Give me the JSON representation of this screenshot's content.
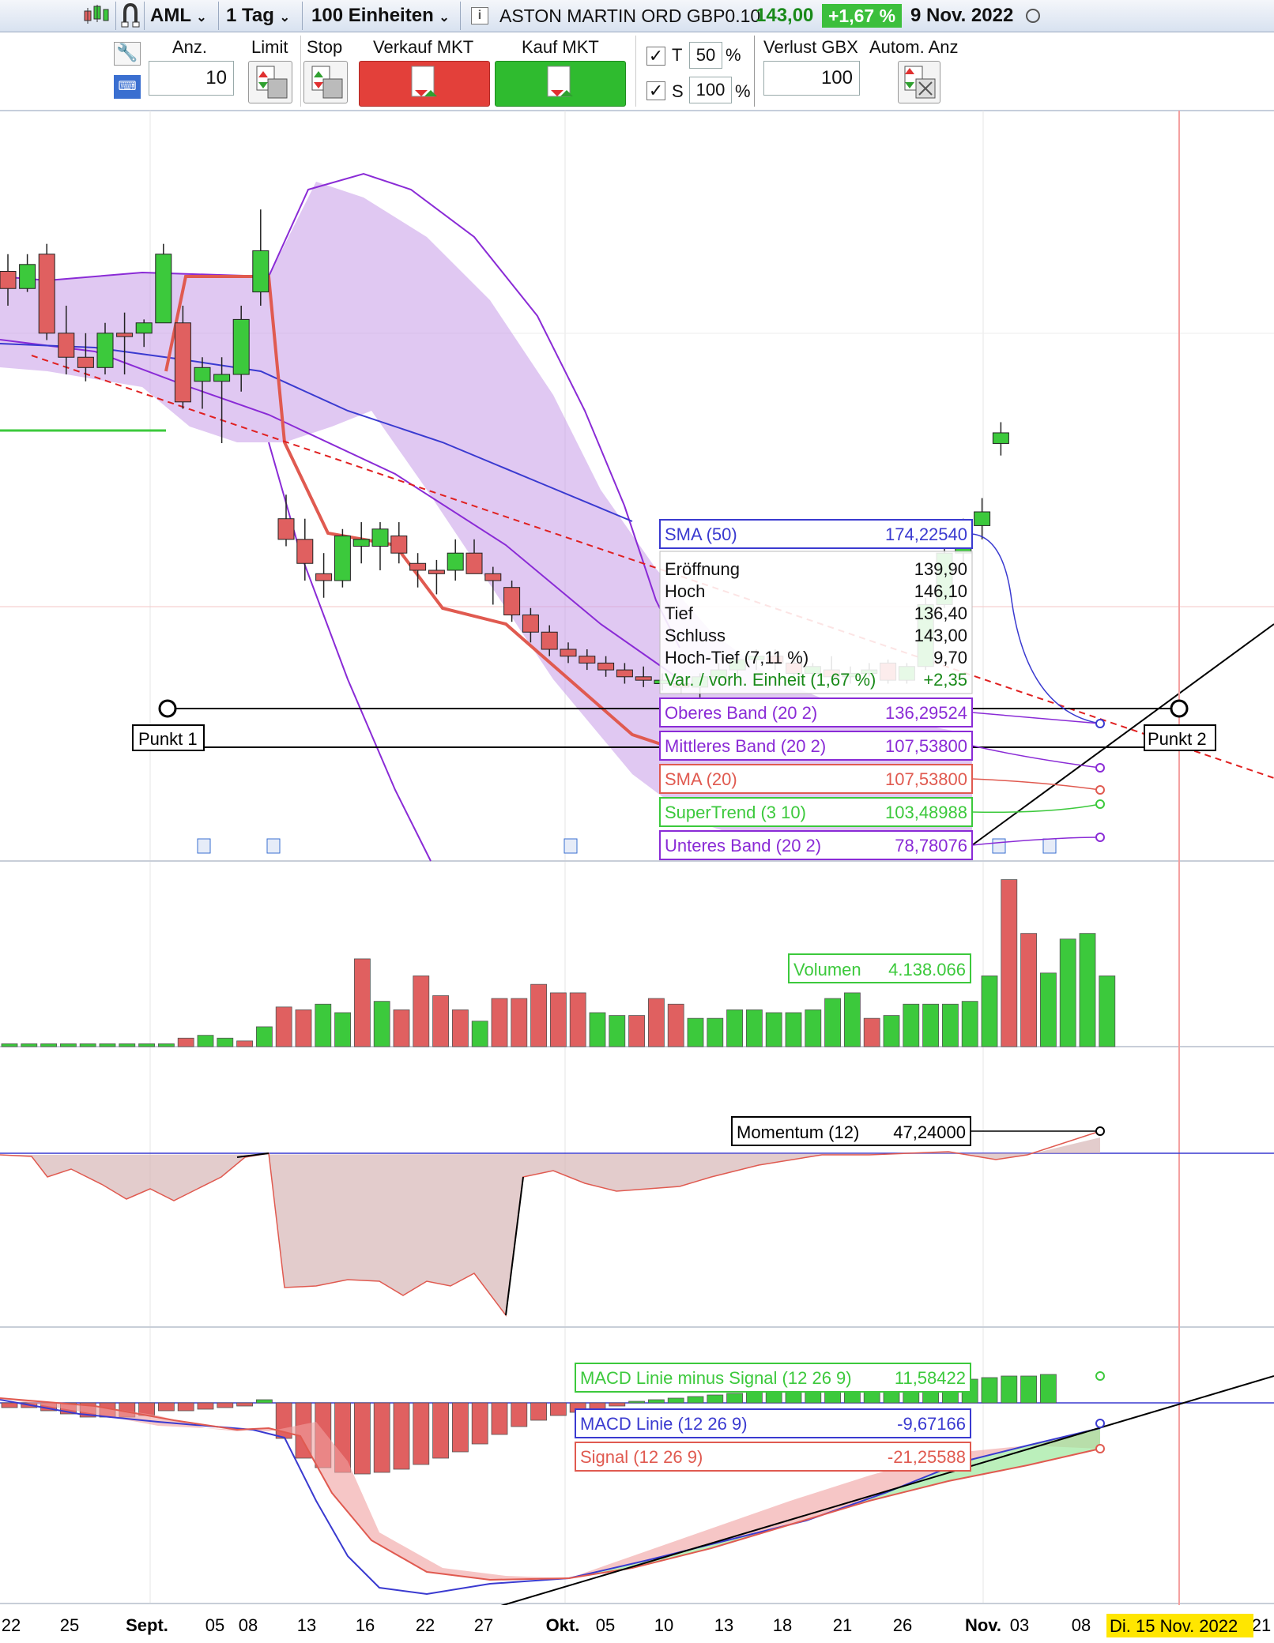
{
  "header": {
    "symbol": "AML",
    "interval": "1 Tag",
    "units": "100 Einheiten",
    "instrument": "ASTON MARTIN ORD GBP0.10",
    "last_price": "143,00",
    "change_pct": "+1,67 %",
    "date": "9 Nov. 2022"
  },
  "toolbar": {
    "qty_label": "Anz.",
    "qty_value": "10",
    "limit_label": "Limit",
    "stop_label": "Stop",
    "sell_label": "Verkauf MKT",
    "buy_label": "Kauf MKT",
    "t_label": "T",
    "t_value": "50",
    "s_label": "S",
    "s_value": "100",
    "pct": "%",
    "loss_label": "Verlust GBX",
    "loss_value": "100",
    "auto_label": "Autom. Anz"
  },
  "tooltip": {
    "rows": [
      {
        "label": "Eröffnung",
        "value": "139,90"
      },
      {
        "label": "Hoch",
        "value": "146,10"
      },
      {
        "label": "Tief",
        "value": "136,40"
      },
      {
        "label": "Schluss",
        "value": "143,00"
      },
      {
        "label": "Hoch-Tief (7,11 %)",
        "value": "9,70"
      },
      {
        "label": "Var. / vorh. Einheit (1,67 %)",
        "value": "+2,35"
      }
    ]
  },
  "indicators": {
    "sma50": {
      "label": "SMA (50)",
      "value": "174,22540"
    },
    "upper": {
      "label": "Oberes Band (20 2)",
      "value": "136,29524"
    },
    "middle": {
      "label": "Mittleres Band (20 2)",
      "value": "107,53800"
    },
    "sma20": {
      "label": "SMA (20)",
      "value": "107,53800"
    },
    "supertrend": {
      "label": "SuperTrend (3 10)",
      "value": "103,48988"
    },
    "lower": {
      "label": "Unteres Band (20 2)",
      "value": "78,78076"
    },
    "volume": {
      "label": "Volumen",
      "value": "4.138.066"
    },
    "momentum": {
      "label": "Momentum (12)",
      "value": "47,24000"
    },
    "macd_hist": {
      "label": "MACD Linie minus Signal (12 26 9)",
      "value": "11,58422"
    },
    "macd_line": {
      "label": "MACD Linie (12 26 9)",
      "value": "-9,67166"
    },
    "macd_signal": {
      "label": "Signal (12 26 9)",
      "value": "-21,25588"
    }
  },
  "annotations": {
    "point1": "Punkt 1",
    "point2": "Punkt 2",
    "cursor_date": "Di. 15 Nov. 2022"
  },
  "colors": {
    "up": "#3cc93c",
    "down": "#e06060",
    "bands": "#8a2bd6",
    "sma50": "#3a3ad0",
    "sma20": "#e05a50",
    "supertrend": "#3cc93c"
  },
  "chart_data": {
    "type": "candlestick",
    "x_labels": [
      {
        "text": "22",
        "bold": false
      },
      {
        "text": "25",
        "bold": false
      },
      {
        "text": "Sept.",
        "bold": true
      },
      {
        "text": "05",
        "bold": false
      },
      {
        "text": "08",
        "bold": false
      },
      {
        "text": "13",
        "bold": false
      },
      {
        "text": "16",
        "bold": false
      },
      {
        "text": "22",
        "bold": false
      },
      {
        "text": "27",
        "bold": false
      },
      {
        "text": "Okt.",
        "bold": true
      },
      {
        "text": "05",
        "bold": false
      },
      {
        "text": "10",
        "bold": false
      },
      {
        "text": "13",
        "bold": false
      },
      {
        "text": "18",
        "bold": false
      },
      {
        "text": "21",
        "bold": false
      },
      {
        "text": "26",
        "bold": false
      },
      {
        "text": "Nov.",
        "bold": true
      },
      {
        "text": "03",
        "bold": false
      },
      {
        "text": "08",
        "bold": false
      },
      {
        "text": "21",
        "bold": false
      }
    ],
    "candles": [
      [
        190,
        195,
        180,
        185
      ],
      [
        185,
        195,
        184,
        192
      ],
      [
        195,
        198,
        170,
        172
      ],
      [
        172,
        180,
        160,
        165
      ],
      [
        165,
        172,
        158,
        162
      ],
      [
        162,
        175,
        160,
        172
      ],
      [
        172,
        178,
        160,
        171
      ],
      [
        172,
        176,
        168,
        175
      ],
      [
        175,
        198,
        176,
        195
      ],
      [
        175,
        180,
        150,
        152
      ],
      [
        158,
        165,
        150,
        162
      ],
      [
        158,
        165,
        140,
        160
      ],
      [
        160,
        180,
        155,
        176
      ],
      [
        184,
        208,
        180,
        196
      ],
      [
        118,
        125,
        110,
        112
      ],
      [
        112,
        118,
        100,
        105
      ],
      [
        102,
        108,
        95,
        100
      ],
      [
        100,
        115,
        98,
        113
      ],
      [
        110,
        117,
        105,
        112
      ],
      [
        110,
        117,
        103,
        115
      ],
      [
        113,
        117,
        105,
        108
      ],
      [
        105,
        108,
        98,
        103
      ],
      [
        103,
        106,
        96,
        102
      ],
      [
        103,
        112,
        100,
        108
      ],
      [
        108,
        112,
        102,
        102
      ],
      [
        102,
        104,
        93,
        100
      ],
      [
        98,
        100,
        88,
        90
      ],
      [
        90,
        92,
        82,
        85
      ],
      [
        85,
        87,
        78,
        80
      ],
      [
        80,
        82,
        76,
        78
      ],
      [
        78,
        80,
        74,
        76
      ],
      [
        76,
        78,
        72,
        74
      ],
      [
        74,
        76,
        70,
        72
      ],
      [
        72,
        75,
        69,
        71
      ],
      [
        70,
        73,
        68,
        71
      ],
      [
        70,
        72,
        67,
        69
      ],
      [
        69,
        73,
        66,
        72
      ],
      [
        72,
        76,
        70,
        74
      ],
      [
        74,
        78,
        71,
        77
      ],
      [
        77,
        80,
        74,
        78
      ],
      [
        78,
        80,
        74,
        76
      ],
      [
        76,
        78,
        72,
        73
      ],
      [
        73,
        76,
        70,
        75
      ],
      [
        74,
        78,
        71,
        72
      ],
      [
        72,
        75,
        70,
        73
      ],
      [
        73,
        76,
        72,
        74
      ],
      [
        76,
        77,
        70,
        71
      ],
      [
        71,
        76,
        70,
        75
      ],
      [
        75,
        95,
        74,
        93
      ],
      [
        93,
        110,
        92,
        108
      ],
      [
        108,
        118,
        105,
        116
      ],
      [
        116,
        124,
        112,
        120
      ],
      [
        139.9,
        146.1,
        136.4,
        143
      ]
    ],
    "volume": [
      1,
      1,
      1,
      1,
      1,
      1,
      1,
      1,
      1,
      3,
      4,
      3,
      2,
      7,
      14,
      13,
      15,
      12,
      31,
      16,
      13,
      25,
      18,
      13,
      9,
      17,
      17,
      22,
      19,
      19,
      12,
      11,
      11,
      17,
      15,
      10,
      10,
      13,
      13,
      12,
      12,
      13,
      17,
      19,
      10,
      11,
      15,
      15,
      15,
      16,
      25,
      59,
      40,
      26,
      38,
      40,
      25
    ],
    "volume_up": [
      1,
      1,
      1,
      1,
      1,
      1,
      1,
      1,
      1,
      0,
      1,
      1,
      0,
      1,
      0,
      0,
      1,
      1,
      0,
      1,
      0,
      0,
      0,
      0,
      1,
      0,
      0,
      0,
      0,
      0,
      1,
      1,
      0,
      0,
      0,
      1,
      1,
      1,
      1,
      1,
      1,
      1,
      1,
      1,
      0,
      1,
      1,
      1,
      1,
      1,
      1,
      0,
      0,
      1,
      1,
      1,
      1
    ]
  }
}
